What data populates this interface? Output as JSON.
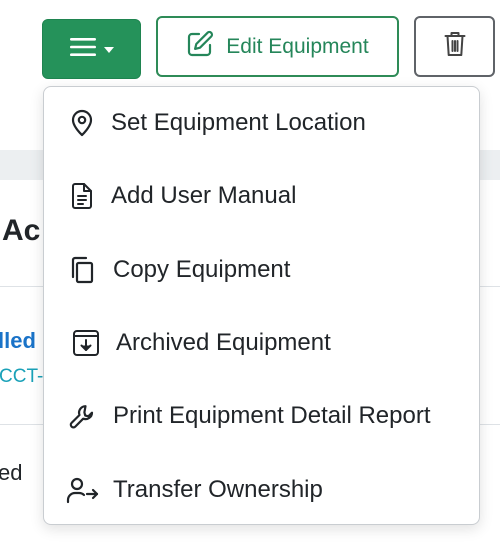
{
  "toolbar": {
    "menu_icon": "hamburger-icon",
    "menu_caret_icon": "caret-down-icon",
    "edit_label": "Edit Equipment",
    "edit_icon": "edit-icon",
    "delete_icon": "trash-icon",
    "accent_color": "#25925a"
  },
  "dropdown": {
    "items": [
      {
        "label": "Set Equipment Location",
        "icon": "map-pin-icon"
      },
      {
        "label": "Add User Manual",
        "icon": "document-icon"
      },
      {
        "label": "Copy Equipment",
        "icon": "copy-icon"
      },
      {
        "label": "Archived Equipment",
        "icon": "archive-download-icon"
      },
      {
        "label": "Print Equipment Detail Report",
        "icon": "wrench-icon"
      },
      {
        "label": "Transfer Ownership",
        "icon": "user-transfer-icon"
      }
    ]
  },
  "background": {
    "heading_partial": "Ac",
    "link_partial": "lled",
    "code_partial": "CCT-",
    "status_partial": "ed"
  }
}
